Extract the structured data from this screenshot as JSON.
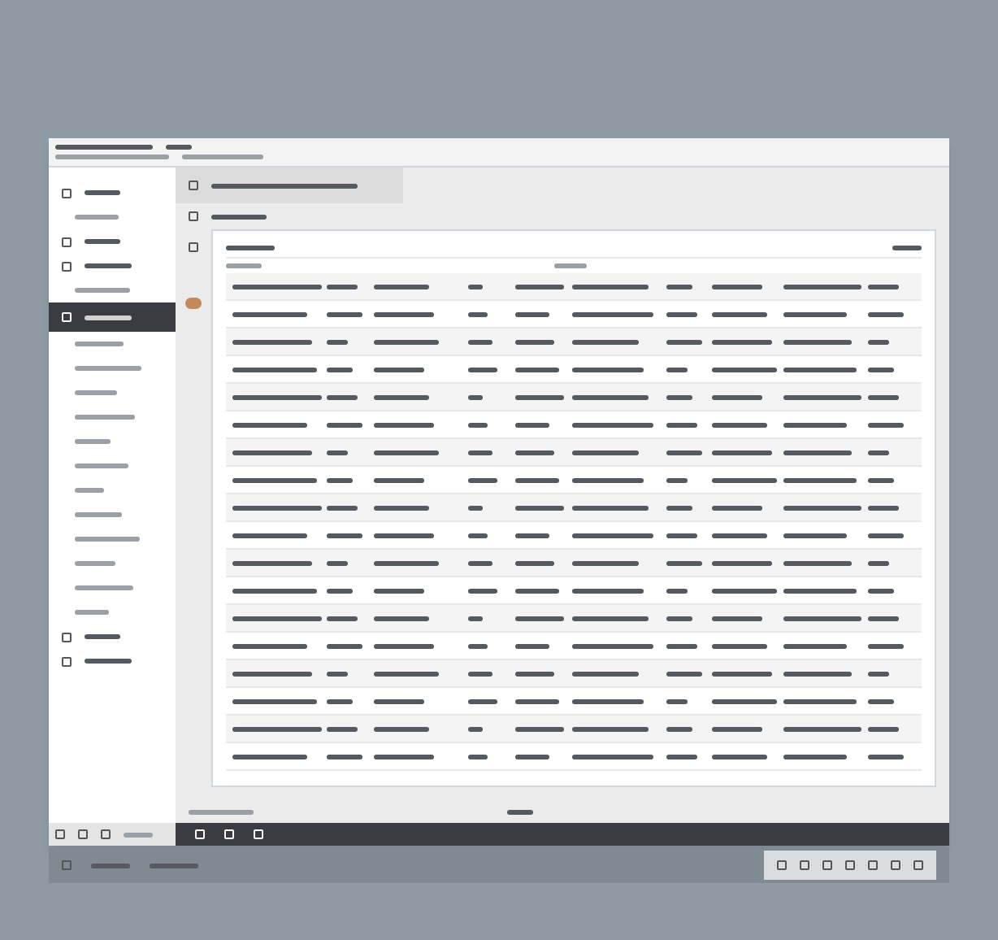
{
  "window": {
    "kind": "blurred"
  },
  "sidebar": {
    "items": [
      {
        "kind": "icon-row",
        "selected": false
      },
      {
        "kind": "sub",
        "selected": false
      },
      {
        "kind": "icon-row",
        "selected": false
      },
      {
        "kind": "icon-row",
        "selected": false
      },
      {
        "kind": "sub",
        "selected": false
      },
      {
        "kind": "icon-row",
        "selected": true
      },
      {
        "kind": "sub",
        "selected": false
      },
      {
        "kind": "sub",
        "selected": false
      },
      {
        "kind": "sub",
        "selected": false
      },
      {
        "kind": "sub",
        "selected": false
      },
      {
        "kind": "sub",
        "selected": false
      },
      {
        "kind": "sub",
        "selected": false
      },
      {
        "kind": "sub",
        "selected": false
      },
      {
        "kind": "sub",
        "selected": false
      },
      {
        "kind": "sub",
        "selected": false
      },
      {
        "kind": "sub",
        "selected": false
      },
      {
        "kind": "sub",
        "selected": false
      },
      {
        "kind": "sub",
        "selected": false
      },
      {
        "kind": "icon-row",
        "selected": false
      },
      {
        "kind": "icon-row",
        "selected": false
      }
    ]
  },
  "table": {
    "columns": [
      {
        "kind": "text"
      },
      {
        "kind": "text"
      },
      {
        "kind": "text"
      },
      {
        "kind": "text"
      },
      {
        "kind": "text"
      },
      {
        "kind": "text"
      },
      {
        "kind": "text"
      },
      {
        "kind": "text"
      },
      {
        "kind": "text"
      },
      {
        "kind": "text"
      }
    ],
    "rows": [
      {
        "kind": "data"
      },
      {
        "kind": "data"
      },
      {
        "kind": "data"
      },
      {
        "kind": "data"
      },
      {
        "kind": "data"
      },
      {
        "kind": "data"
      },
      {
        "kind": "data"
      },
      {
        "kind": "data"
      },
      {
        "kind": "data"
      },
      {
        "kind": "data"
      },
      {
        "kind": "data"
      },
      {
        "kind": "data"
      },
      {
        "kind": "data"
      },
      {
        "kind": "data"
      },
      {
        "kind": "data"
      },
      {
        "kind": "data"
      },
      {
        "kind": "data"
      },
      {
        "kind": "data"
      }
    ]
  }
}
